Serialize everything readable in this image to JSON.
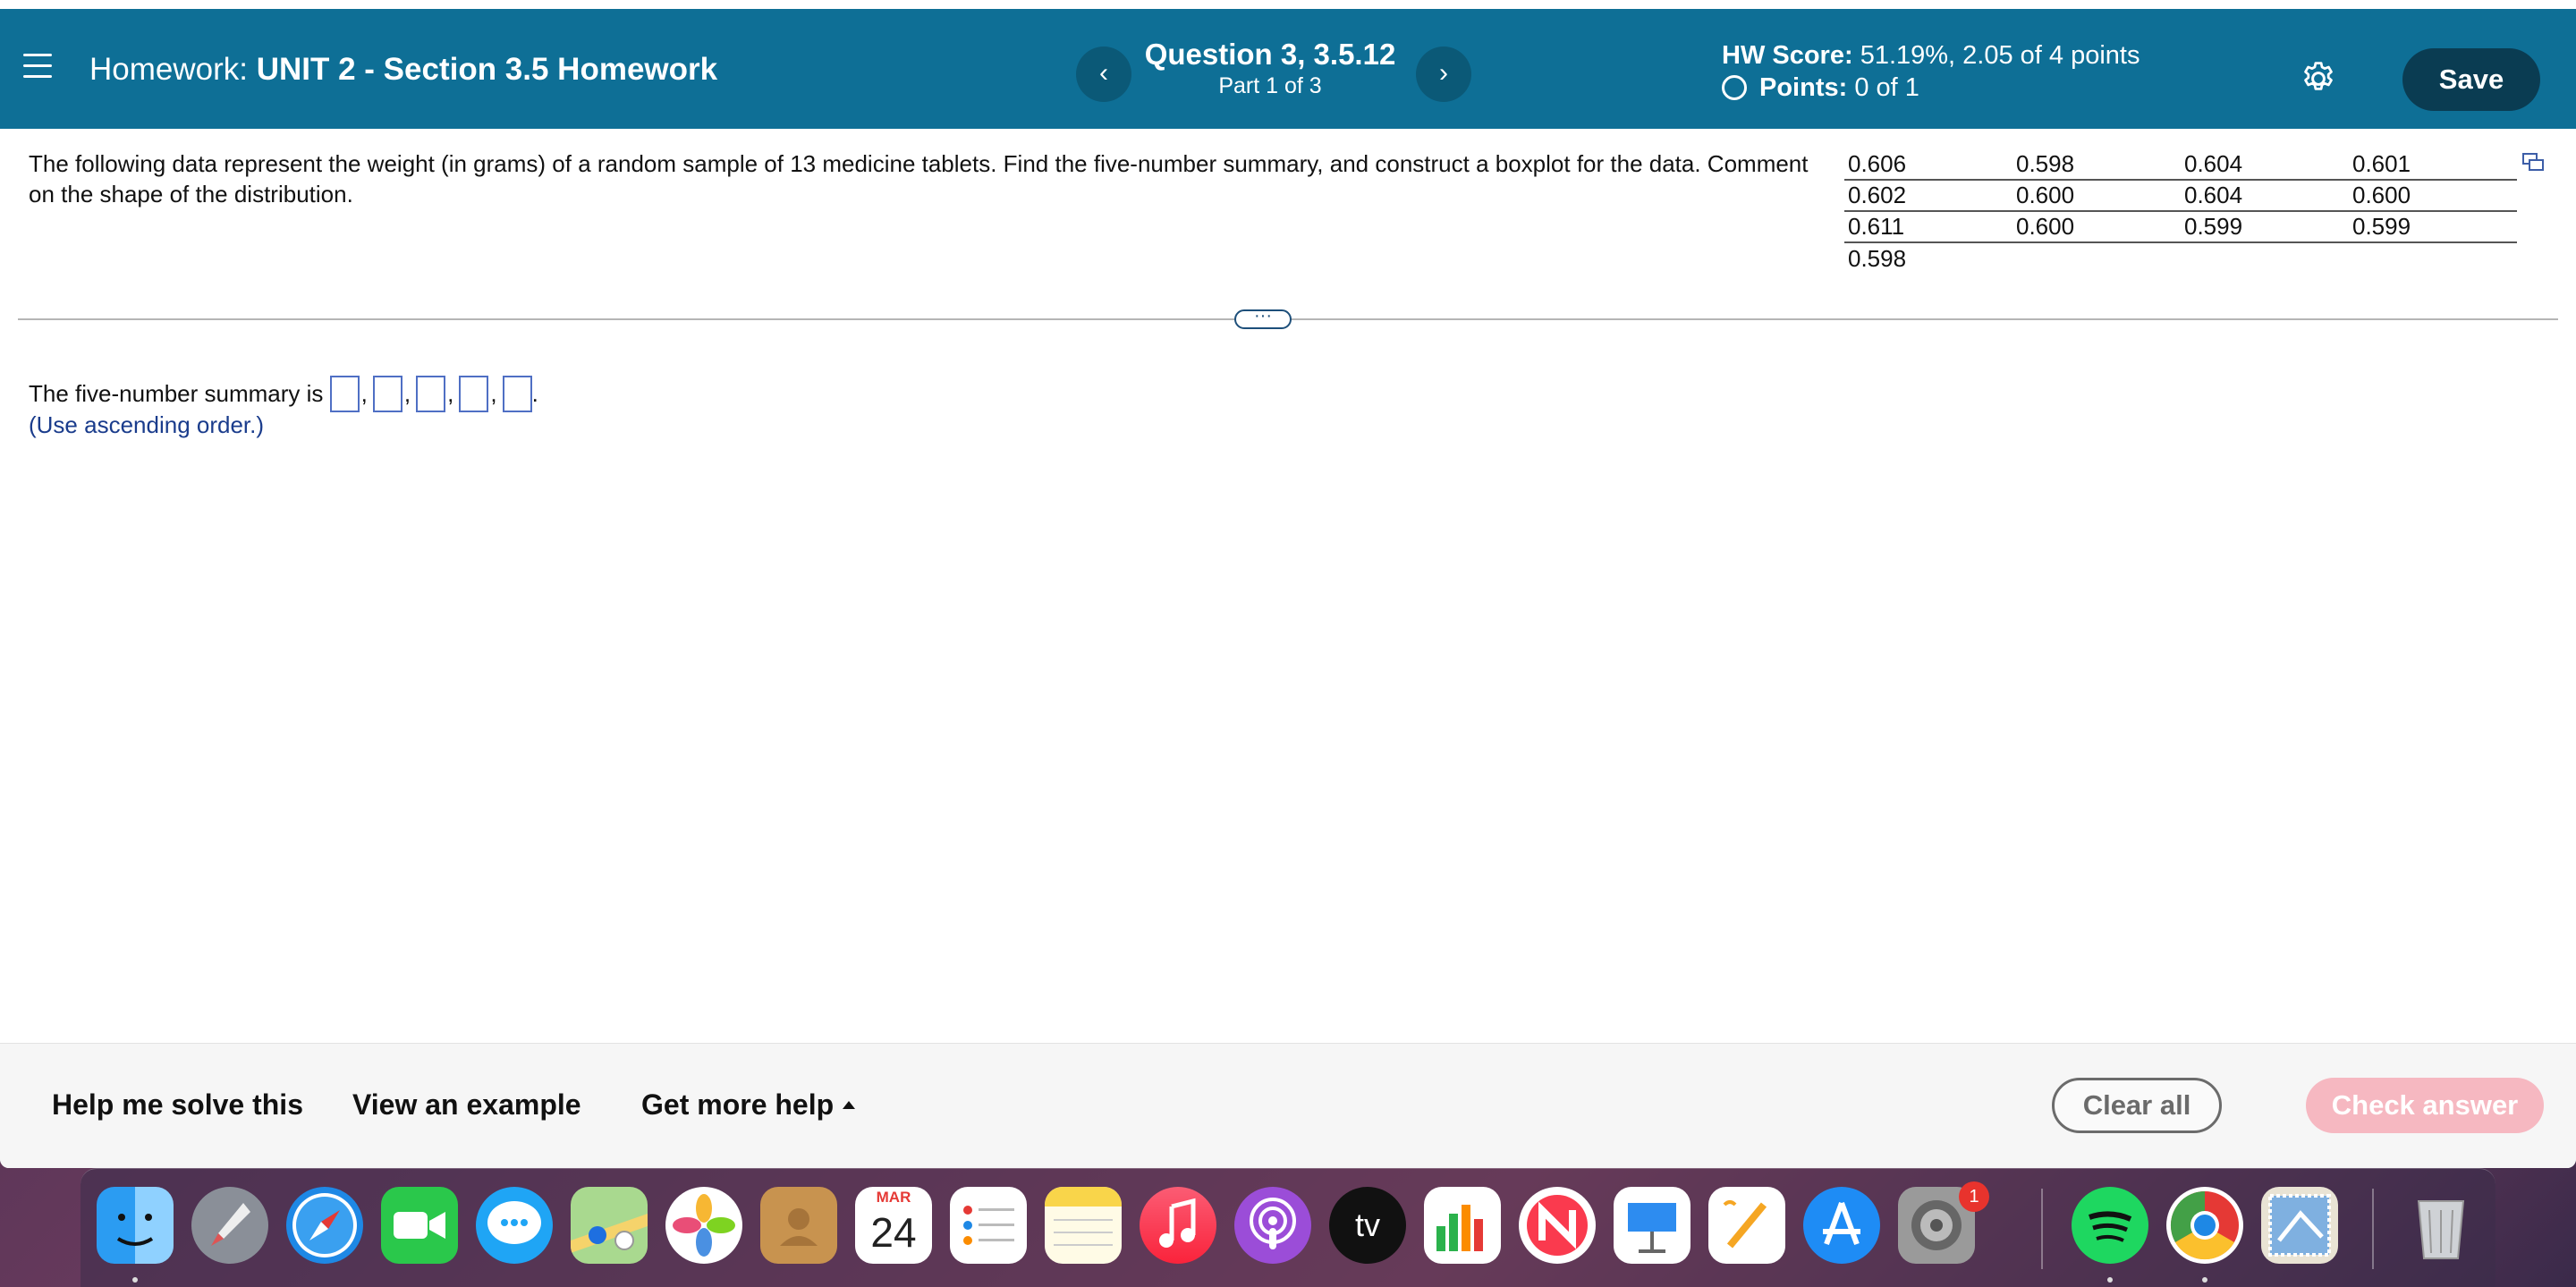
{
  "header": {
    "title_prefix": "Homework:",
    "title": "UNIT 2 - Section 3.5 Homework",
    "question_title": "Question 3, 3.5.12",
    "question_part": "Part 1 of 3",
    "hw_score_label": "HW Score:",
    "hw_score_value": "51.19%, 2.05 of 4 points",
    "points_label": "Points:",
    "points_value": "0 of 1",
    "prev_label": "‹",
    "next_label": "›",
    "save_label": "Save"
  },
  "question": {
    "text": "The following data represent the weight (in grams) of a random sample of 13 medicine tablets. Find the five-number summary, and construct a boxplot for the data. Comment on the shape of the distribution.",
    "data_rows": [
      [
        "0.606",
        "0.598",
        "0.604",
        "0.601"
      ],
      [
        "0.602",
        "0.600",
        "0.604",
        "0.600"
      ],
      [
        "0.611",
        "0.600",
        "0.599",
        "0.599"
      ],
      [
        "0.598",
        "",
        "",
        ""
      ]
    ]
  },
  "divider_handle": "···",
  "answer": {
    "prompt": "The five-number summary is",
    "separator": ",",
    "end": ".",
    "hint": "(Use ascending order.)"
  },
  "footer": {
    "help_solve": "Help me solve this",
    "view_example": "View an example",
    "more_help": "Get more help",
    "clear_all": "Clear all",
    "check_answer": "Check answer"
  },
  "dock": {
    "calendar_month": "MAR",
    "calendar_day": "24",
    "tv_label": "tv",
    "settings_badge": "1"
  },
  "colors": {
    "header_bg": "#0e6f96",
    "save_bg": "#0a3c52",
    "check_bg": "#f6b8c1",
    "hint": "#1a3c8c",
    "input_border": "#4f6fc4"
  }
}
